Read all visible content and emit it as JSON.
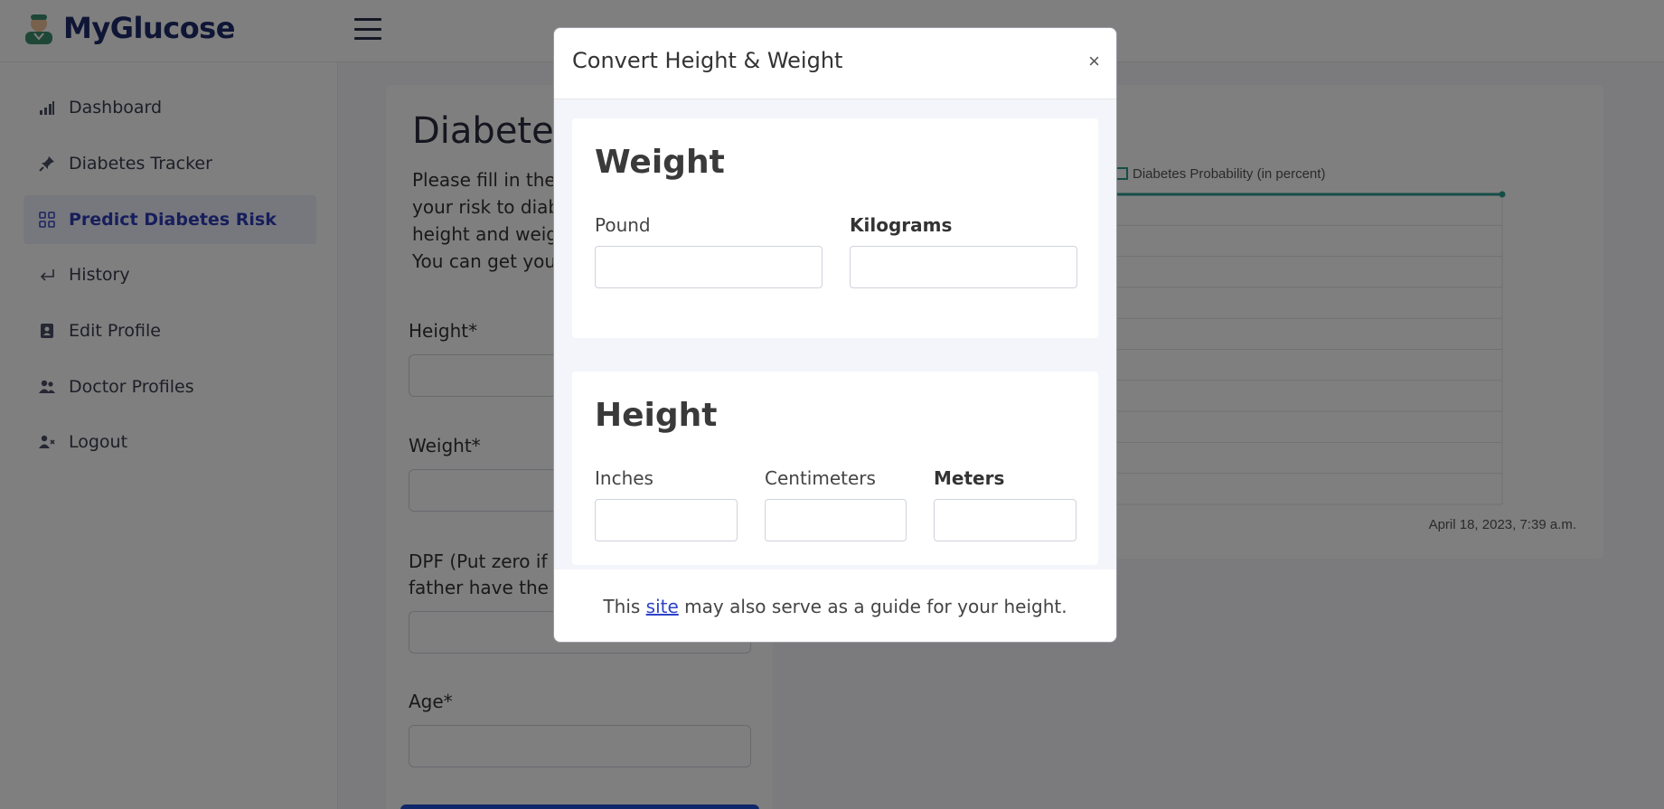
{
  "header": {
    "brand_name": "MyGlucose",
    "logo_icon": "doctor-avatar-icon",
    "menu_icon": "hamburger-icon"
  },
  "sidebar": {
    "items": [
      {
        "label": "Dashboard",
        "icon": "bar-chart-icon",
        "active": false
      },
      {
        "label": "Diabetes Tracker",
        "icon": "pin-icon",
        "active": false
      },
      {
        "label": "Predict Diabetes Risk",
        "icon": "grid-icon",
        "active": true
      },
      {
        "label": "History",
        "icon": "return-arrow-icon",
        "active": false
      },
      {
        "label": "Edit Profile",
        "icon": "contact-book-icon",
        "active": false
      },
      {
        "label": "Doctor Profiles",
        "icon": "users-icon",
        "active": false
      },
      {
        "label": "Logout",
        "icon": "user-x-icon",
        "active": false
      }
    ]
  },
  "main": {
    "title": "Diabetes",
    "intro_lines": [
      "Please fill in the i",
      "your risk to diabe",
      "height and weigh",
      "You can get your"
    ],
    "fields": {
      "height_label": "Height*",
      "weight_label": "Weight*",
      "dpf_label_line1": "DPF (Put zero if n",
      "dpf_label_line2": "father have the d",
      "age_label": "Age*"
    }
  },
  "chart": {
    "legend_label": "Diabetes Probability (in percent)",
    "x_tick": "April 18, 2023, 7:39 a.m."
  },
  "chart_data": {
    "type": "line",
    "title": "",
    "series": [
      {
        "name": "Diabetes Probability (in percent)",
        "values": [
          null
        ]
      }
    ],
    "categories": [
      "April 18, 2023, 7:39 a.m."
    ],
    "grid": true,
    "legend": "top"
  },
  "modal": {
    "title": "Convert Height & Weight",
    "close_symbol": "×",
    "weight": {
      "title": "Weight",
      "pound_label": "Pound",
      "kilograms_label": "Kilograms",
      "pound_value": "",
      "kilograms_value": ""
    },
    "height": {
      "title": "Height",
      "inches_label": "Inches",
      "centimeters_label": "Centimeters",
      "meters_label": "Meters",
      "inches_value": "",
      "centimeters_value": "",
      "meters_value": ""
    },
    "footer": {
      "before_link": "This ",
      "link_text": "site",
      "after_link": " may also serve as a guide for your height."
    }
  },
  "colors": {
    "brand": "#1c2a6b",
    "active_nav": "#2f3cb8",
    "chart_line": "#2a9d8f",
    "link": "#2e43c9",
    "backdrop": "rgba(0,0,0,0.5)"
  }
}
